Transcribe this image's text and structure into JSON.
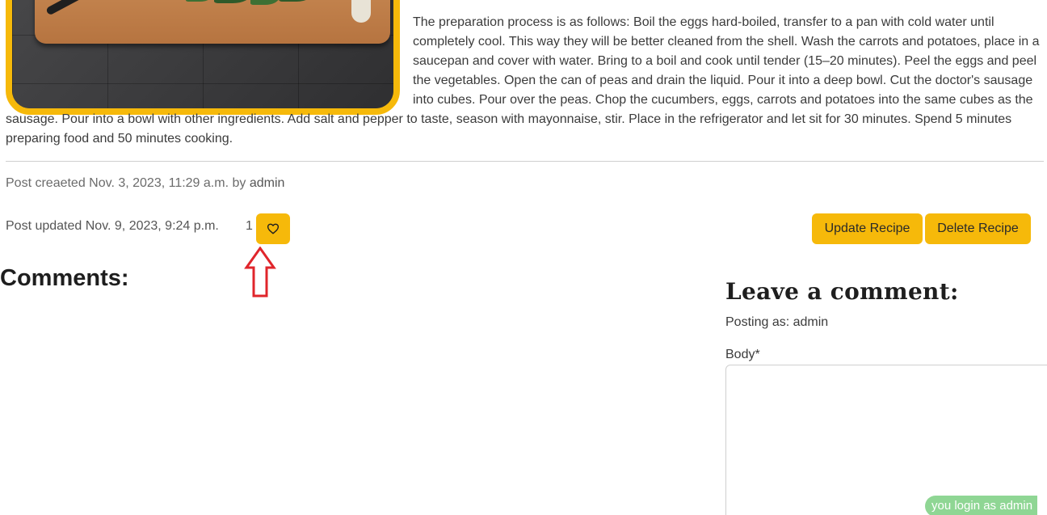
{
  "recipe": {
    "description": "The preparation process is as follows: Boil the eggs hard-boiled, transfer to a pan with cold water until completely cool. This way they will be better cleaned from the shell. Wash the carrots and potatoes, place in a saucepan and cover with water. Bring to a boil and cook until tender (15–20 minutes). Peel the eggs and peel the vegetables. Open the can of peas and drain the liquid. Pour it into a deep bowl. Cut the doctor's sausage into cubes. Pour over the peas. Chop the cucumbers, eggs, carrots and potatoes into the same cubes as the sausage. Pour into a bowl with other ingredients. Add salt and pepper to taste, season with mayonnaise, stir. Place in the refrigerator and let sit for 30 minutes. Spend 5 minutes preparing food and 50 minutes cooking."
  },
  "meta": {
    "created_prefix": "Post creaeted Nov. 3, 2023, 11:29 a.m. by",
    "created_author": "admin",
    "updated_text": "Post updated Nov. 9, 2023, 9:24 p.m.",
    "like_count": "1",
    "like_icon": "heart-outline-icon"
  },
  "actions": {
    "update_label": "Update Recipe",
    "delete_label": "Delete Recipe"
  },
  "comments": {
    "heading": "Comments:"
  },
  "comment_form": {
    "heading": "Leave a comment:",
    "posting_as": "Posting as: admin",
    "body_label": "Body*",
    "body_value": ""
  },
  "status": {
    "login_badge": "you login as admin"
  },
  "colors": {
    "accent": "#f6b90a",
    "annotation_arrow": "#e0252b",
    "login_badge": "#8fd694"
  }
}
